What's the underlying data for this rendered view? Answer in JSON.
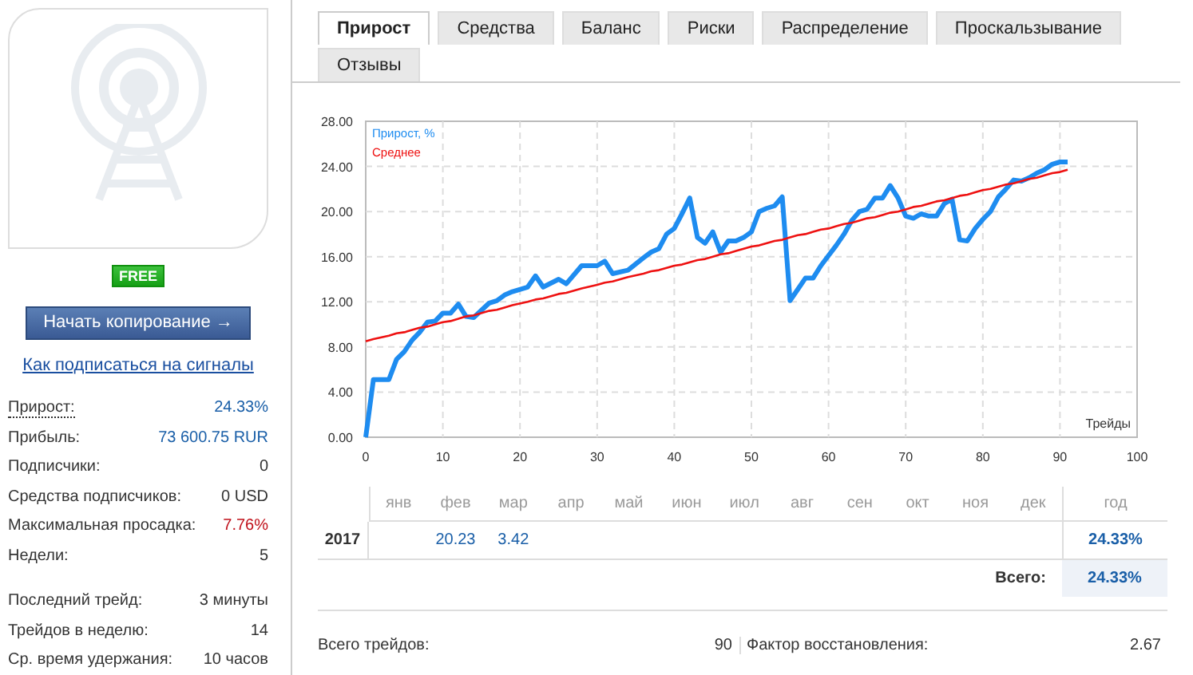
{
  "sidebar": {
    "badge": "FREE",
    "copy_button": "Начать копирование →",
    "help_link": "Как подписаться на сигналы",
    "stats": [
      [
        {
          "label": "Прирост:",
          "value": "24.33%",
          "kind": "hint",
          "color": "#1a5fa8"
        },
        {
          "label": "Прибыль:",
          "value": "73 600.75 RUR",
          "kind": "plain",
          "color": "#1a5fa8"
        },
        {
          "label": "Подписчики:",
          "value": "0",
          "kind": "plain",
          "color": "#333333"
        },
        {
          "label": "Средства подписчиков:",
          "value": "0 USD",
          "kind": "plain",
          "color": "#333333"
        },
        {
          "label": "Максимальная просадка:",
          "value": "7.76%",
          "kind": "plain",
          "color": "#c0101a"
        },
        {
          "label": "Недели:",
          "value": "5",
          "kind": "plain",
          "color": "#333333"
        }
      ],
      [
        {
          "label": "Последний трейд:",
          "value": "3 минуты",
          "kind": "plain",
          "color": "#333333"
        },
        {
          "label": "Трейдов в неделю:",
          "value": "14",
          "kind": "plain",
          "color": "#333333"
        },
        {
          "label": "Ср. время удержания:",
          "value": "10 часов",
          "kind": "plain",
          "color": "#333333"
        }
      ]
    ]
  },
  "tabs": [
    {
      "label": "Прирост",
      "selected": true
    },
    {
      "label": "Средства",
      "selected": false
    },
    {
      "label": "Баланс",
      "selected": false
    },
    {
      "label": "Риски",
      "selected": false
    },
    {
      "label": "Распределение",
      "selected": false
    },
    {
      "label": "Проскальзывание",
      "selected": false
    },
    {
      "label": "Отзывы",
      "selected": false
    }
  ],
  "chart": {
    "chart_data": {
      "type": "line",
      "grid": true,
      "xlabel": "Трейды",
      "xlim": [
        0,
        100
      ],
      "ylim": [
        0,
        28
      ],
      "xticks": [
        0,
        10,
        20,
        30,
        40,
        50,
        60,
        70,
        80,
        90,
        100
      ],
      "yticks": [
        {
          "value": 0,
          "label": "0.00"
        },
        {
          "value": 4,
          "label": "4.00"
        },
        {
          "value": 8,
          "label": "8.00"
        },
        {
          "value": 12,
          "label": "12.00"
        },
        {
          "value": 16,
          "label": "16.00"
        },
        {
          "value": 20,
          "label": "20.00"
        },
        {
          "value": 24,
          "label": "24.00"
        },
        {
          "value": 28,
          "label": "28.00"
        }
      ],
      "x": [
        0,
        1,
        3,
        4,
        5,
        6,
        7,
        8,
        9,
        10,
        11,
        12,
        13,
        14,
        16,
        17,
        18,
        19,
        21,
        22,
        23,
        25,
        26,
        28,
        30,
        31,
        32,
        34,
        36,
        37,
        38,
        39,
        40,
        41,
        42,
        43,
        44,
        45,
        46,
        47,
        48,
        49,
        50,
        51,
        52,
        53,
        54,
        55,
        56,
        57,
        58,
        59,
        60,
        61,
        62,
        63,
        64,
        65,
        66,
        67,
        68,
        69,
        70,
        71,
        72,
        73,
        74,
        75,
        76,
        77,
        78,
        79,
        80,
        81,
        82,
        83,
        84,
        85,
        86,
        87,
        88,
        89,
        90,
        91
      ],
      "series": [
        {
          "name": "Прирост, %",
          "color": "#1e8cf0",
          "values": [
            0,
            5.1,
            5.1,
            6.9,
            7.6,
            8.6,
            9.3,
            10.2,
            10.3,
            11,
            11,
            11.8,
            10.7,
            10.6,
            11.9,
            12.1,
            12.6,
            12.9,
            13.3,
            14.3,
            13.3,
            14,
            13.6,
            15.2,
            15.2,
            15.6,
            14.5,
            14.8,
            15.9,
            16.4,
            16.7,
            18,
            18.5,
            19.8,
            21.2,
            17.7,
            17.2,
            18.2,
            16.4,
            17.4,
            17.4,
            17.7,
            18.2,
            20,
            20.3,
            20.5,
            21.3,
            12.1,
            13.1,
            14.1,
            14.1,
            15.2,
            16.1,
            17,
            18,
            19.2,
            20,
            20.2,
            21.2,
            21.2,
            22.3,
            21.2,
            19.6,
            19.4,
            19.8,
            19.6,
            19.6,
            20.7,
            21.1,
            17.5,
            17.4,
            18.5,
            19.3,
            20,
            21.3,
            22,
            22.8,
            22.7,
            23,
            23.4,
            23.7,
            24.2,
            24.4,
            24.4
          ]
        },
        {
          "name": "Среднее",
          "color": "#ee1111",
          "values": [
            8.5,
            8.7,
            9.0,
            9.2,
            9.3,
            9.5,
            9.7,
            9.8,
            10.0,
            10.2,
            10.3,
            10.5,
            10.7,
            10.8,
            11.2,
            11.3,
            11.5,
            11.7,
            12.0,
            12.2,
            12.3,
            12.7,
            12.8,
            13.2,
            13.5,
            13.7,
            13.8,
            14.2,
            14.5,
            14.7,
            14.8,
            15.0,
            15.2,
            15.3,
            15.5,
            15.7,
            15.8,
            16.0,
            16.2,
            16.3,
            16.5,
            16.7,
            16.9,
            17.0,
            17.2,
            17.4,
            17.5,
            17.7,
            17.9,
            18.0,
            18.2,
            18.4,
            18.5,
            18.7,
            18.9,
            19.0,
            19.2,
            19.4,
            19.5,
            19.7,
            19.9,
            20.0,
            20.2,
            20.4,
            20.5,
            20.7,
            20.9,
            21.0,
            21.2,
            21.4,
            21.5,
            21.7,
            21.9,
            22.0,
            22.2,
            22.4,
            22.5,
            22.7,
            22.9,
            23.0,
            23.2,
            23.4,
            23.5,
            23.7
          ]
        }
      ]
    }
  },
  "monthly": {
    "year_header": "год",
    "months": [
      {
        "label": "янв"
      },
      {
        "label": "фев",
        "values": [
          "20.23"
        ]
      },
      {
        "label": "мар",
        "values": [
          "3.42"
        ]
      },
      {
        "label": "апр"
      },
      {
        "label": "май"
      },
      {
        "label": "июн"
      },
      {
        "label": "июл"
      },
      {
        "label": "авг"
      },
      {
        "label": "сен"
      },
      {
        "label": "окт"
      },
      {
        "label": "ноя"
      },
      {
        "label": "дек"
      }
    ],
    "rows": [
      {
        "year": "2017",
        "total": "24.33%"
      }
    ],
    "total_label": "Всего:",
    "total_value": "24.33%"
  },
  "summary": [
    {
      "label": "Всего трейдов:",
      "value": "90"
    },
    {
      "label": "Фактор восстановления:",
      "value": "2.67"
    }
  ]
}
